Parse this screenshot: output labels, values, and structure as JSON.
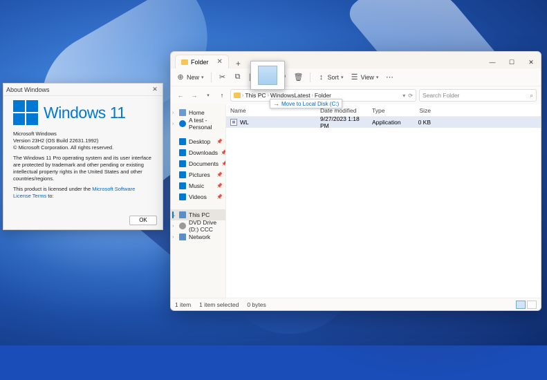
{
  "about": {
    "title": "About Windows",
    "brand": "Windows 11",
    "line1": "Microsoft Windows",
    "line2": "Version 23H2 (OS Build 22631.1992)",
    "line3": "© Microsoft Corporation. All rights reserved.",
    "rights": "The Windows 11 Pro operating system and its user interface are protected by trademark and other pending or existing intellectual property rights in the United States and other countries/regions.",
    "license_pre": "This product is licensed under the ",
    "license_link": "Microsoft Software License Terms",
    "license_post": " to:",
    "ok": "OK"
  },
  "explorer": {
    "tab": "Folder",
    "toolbar": {
      "new": "New",
      "sort": "Sort",
      "view": "View"
    },
    "breadcrumb": [
      "This PC",
      "WindowsLatest",
      "Folder"
    ],
    "search_placeholder": "Search Folder",
    "nav": {
      "home": "Home",
      "personal": "A test - Personal",
      "desktop": "Desktop",
      "downloads": "Downloads",
      "documents": "Documents",
      "pictures": "Pictures",
      "music": "Music",
      "videos": "Videos",
      "thispc": "This PC",
      "dvd": "DVD Drive (D:) CCC",
      "network": "Network"
    },
    "columns": {
      "name": "Name",
      "date": "Date modified",
      "type": "Type",
      "size": "Size"
    },
    "rows": [
      {
        "name": "WL",
        "date": "9/27/2023 1:18 PM",
        "type": "Application",
        "size": "0 KB"
      }
    ],
    "status": {
      "count": "1 item",
      "sel": "1 item selected",
      "bytes": "0 bytes"
    }
  },
  "drag_hint": "Move to Local Disk (C:)"
}
